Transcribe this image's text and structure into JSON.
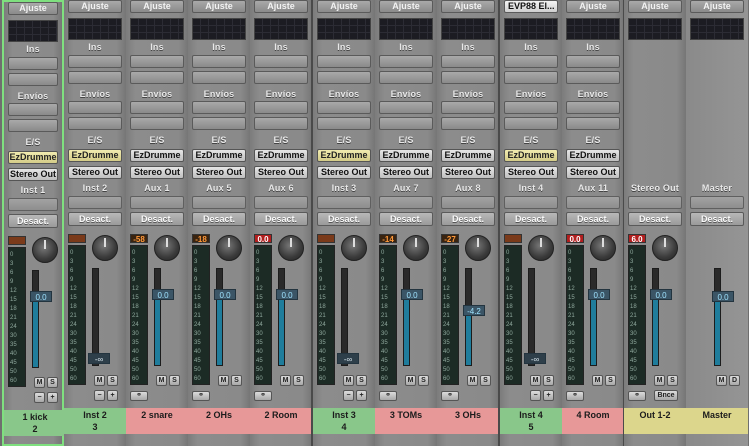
{
  "colors": {
    "green": "#89c78a",
    "pink": "#e79898",
    "yellow": "#dcd68c",
    "fader": "#1f7d9c",
    "selected": "#7fe07f"
  },
  "sections": {
    "settings": "Ajuste",
    "inserts": "Ins",
    "sends": "Envíos",
    "io": "E/S"
  },
  "strips": [
    {
      "name": "1 kick",
      "number": "2",
      "color": "green",
      "selected": true,
      "plugin": "",
      "input": "EzDrumme",
      "input_style": "yellow",
      "output": "Stereo Out",
      "slot_label": "Inst 1",
      "automation": "Desact.",
      "peak": "",
      "peak_level": "idle",
      "fader_value": "0.0",
      "fader_fraction": 0.72,
      "mute": "M",
      "solo": "S",
      "link": false
    },
    {
      "name": "Inst 2",
      "number": "3",
      "color": "green",
      "selected": false,
      "plugin": "",
      "input": "EzDrumme",
      "input_style": "yellow",
      "output": "Stereo Out",
      "slot_label": "Inst 2",
      "automation": "Desact.",
      "peak": "",
      "peak_level": "idle",
      "fader_value": "-∞",
      "fader_fraction": 0.0,
      "mute": "M",
      "solo": "S",
      "link": false
    },
    {
      "name": "2 snare",
      "number": "",
      "color": "pink",
      "selected": false,
      "plugin": "",
      "input": "EzDrumme",
      "input_style": "grey",
      "output": "Stereo Out",
      "slot_label": "Aux 1",
      "automation": "Desact.",
      "peak": "-58",
      "peak_level": "warn",
      "fader_value": "0.0",
      "fader_fraction": 0.72,
      "mute": "M",
      "solo": "S",
      "link": true
    },
    {
      "name": "2 OHs",
      "number": "",
      "color": "pink",
      "selected": false,
      "plugin": "",
      "input": "EzDrumme",
      "input_style": "grey",
      "output": "Stereo Out",
      "slot_label": "Aux 5",
      "automation": "Desact.",
      "peak": "-18",
      "peak_level": "warn",
      "fader_value": "0.0",
      "fader_fraction": 0.72,
      "mute": "M",
      "solo": "S",
      "link": true
    },
    {
      "name": "2 Room",
      "number": "",
      "color": "pink",
      "selected": false,
      "plugin": "",
      "input": "EzDrumme",
      "input_style": "grey",
      "output": "Stereo Out",
      "slot_label": "Aux 6",
      "automation": "Desact.",
      "peak": "0.0",
      "peak_level": "clip",
      "fader_value": "0.0",
      "fader_fraction": 0.72,
      "mute": "M",
      "solo": "S",
      "link": true
    },
    {
      "name": "Inst 3",
      "number": "4",
      "color": "green",
      "selected": false,
      "plugin": "",
      "input": "EzDrumme",
      "input_style": "yellow",
      "output": "Stereo Out",
      "slot_label": "Inst 3",
      "automation": "Desact.",
      "peak": "",
      "peak_level": "idle",
      "fader_value": "-∞",
      "fader_fraction": 0.0,
      "mute": "M",
      "solo": "S",
      "link": false
    },
    {
      "name": "3 TOMs",
      "number": "",
      "color": "pink",
      "selected": false,
      "plugin": "",
      "input": "EzDrumme",
      "input_style": "grey",
      "output": "Stereo Out",
      "slot_label": "Aux 7",
      "automation": "Desact.",
      "peak": "-14",
      "peak_level": "warn",
      "fader_value": "0.0",
      "fader_fraction": 0.72,
      "mute": "M",
      "solo": "S",
      "link": true
    },
    {
      "name": "3 OHs",
      "number": "",
      "color": "pink",
      "selected": false,
      "plugin": "",
      "input": "EzDrumme",
      "input_style": "grey",
      "output": "Stereo Out",
      "slot_label": "Aux 8",
      "automation": "Desact.",
      "peak": "-27",
      "peak_level": "warn",
      "fader_value": "-4.2",
      "fader_fraction": 0.55,
      "mute": "M",
      "solo": "S",
      "link": true
    },
    {
      "name": "Inst 4",
      "number": "5",
      "color": "green",
      "selected": false,
      "plugin": "EVP88 El...",
      "input": "EzDrumme",
      "input_style": "yellow",
      "output": "Stereo Out",
      "slot_label": "Inst 4",
      "automation": "Desact.",
      "peak": "",
      "peak_level": "idle",
      "fader_value": "-∞",
      "fader_fraction": 0.0,
      "mute": "M",
      "solo": "S",
      "link": false
    },
    {
      "name": "4 Room",
      "number": "",
      "color": "pink",
      "selected": false,
      "plugin": "",
      "input": "EzDrumme",
      "input_style": "grey",
      "output": "Stereo Out",
      "slot_label": "Aux 11",
      "automation": "Desact.",
      "peak": "0.0",
      "peak_level": "clip",
      "fader_value": "0.0",
      "fader_fraction": 0.72,
      "mute": "M",
      "solo": "S",
      "link": true
    },
    {
      "name": "Out 1-2",
      "number": "",
      "color": "yellow",
      "selected": false,
      "plugin": "",
      "input": "",
      "input_style": "",
      "output": "",
      "slot_label": "Stereo Out",
      "automation": "Desact.",
      "peak": "6.0",
      "peak_level": "clip",
      "fader_value": "0.0",
      "fader_fraction": 0.72,
      "mute": "M",
      "solo": "S",
      "link": true,
      "bounce": "Bnce"
    },
    {
      "name": "Master",
      "number": "",
      "color": "yellow",
      "selected": false,
      "plugin": "",
      "input": "",
      "input_style": "",
      "output": "",
      "slot_label": "Master",
      "automation": "Desact.",
      "peak": "",
      "peak_level": "none",
      "fader_value": "0.0",
      "fader_fraction": 0.72,
      "mute": "M",
      "solo": "D",
      "link": false,
      "master": true
    }
  ],
  "meter_ticks": [
    "0",
    "3",
    "6",
    "9",
    "12",
    "15",
    "18",
    "21",
    "24",
    "30",
    "35",
    "40",
    "45",
    "50",
    "60"
  ]
}
